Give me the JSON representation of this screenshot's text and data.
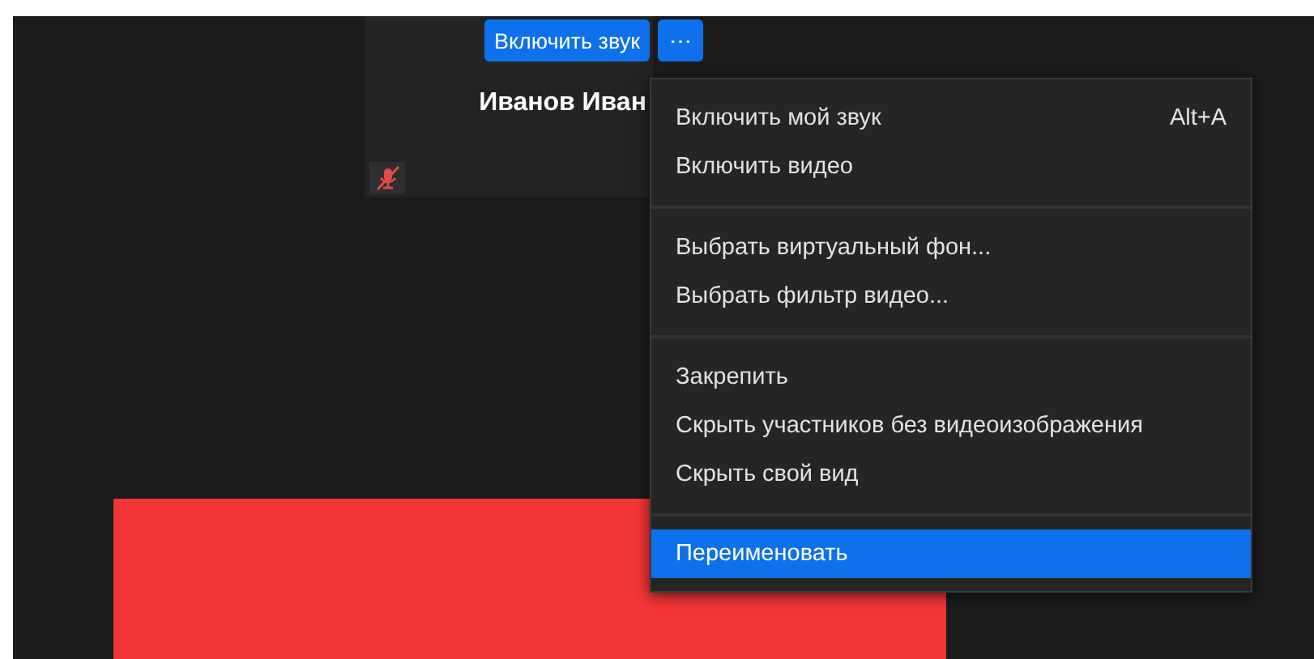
{
  "tile": {
    "unmute_button": "Включить звук",
    "more_button": "⋯",
    "name": "Иванов Иван",
    "muted": true
  },
  "menu": {
    "groups": [
      {
        "items": [
          {
            "label": "Включить мой звук",
            "shortcut": "Alt+A",
            "selected": false
          },
          {
            "label": "Включить видео",
            "selected": false
          }
        ]
      },
      {
        "items": [
          {
            "label": "Выбрать виртуальный фон...",
            "selected": false
          },
          {
            "label": "Выбрать фильтр видео...",
            "selected": false
          }
        ]
      },
      {
        "items": [
          {
            "label": "Закрепить",
            "selected": false
          },
          {
            "label": "Скрыть участников без видеоизображения",
            "selected": false
          },
          {
            "label": "Скрыть свой вид",
            "selected": false
          }
        ]
      },
      {
        "items": [
          {
            "label": "Переименовать",
            "selected": true
          }
        ]
      }
    ]
  }
}
